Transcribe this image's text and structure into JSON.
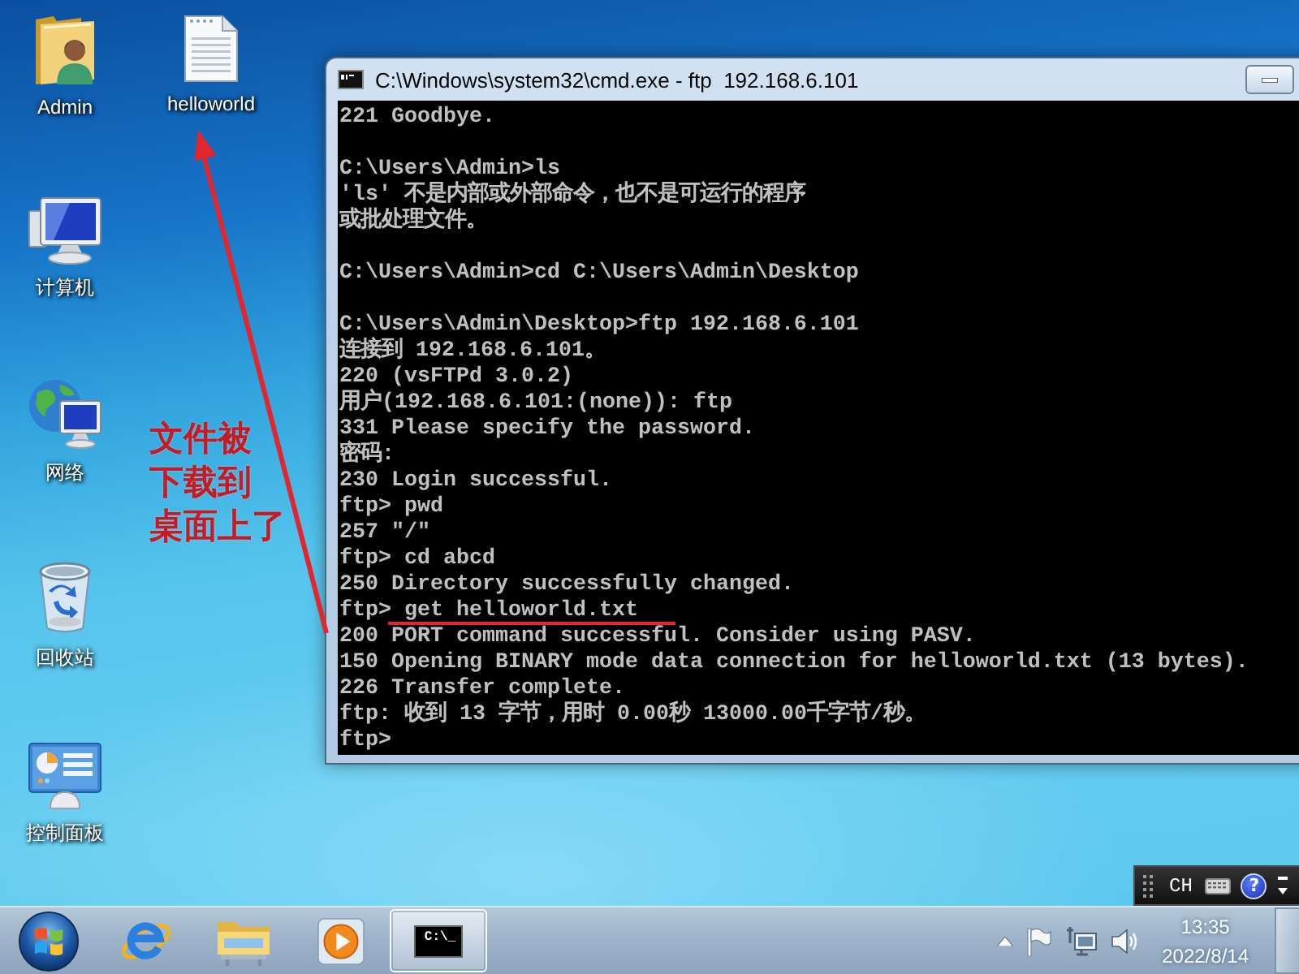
{
  "desktop": {
    "icon_columns": [
      [
        {
          "kind": "user-folder",
          "label": "Admin"
        },
        {
          "kind": "computer",
          "label": "计算机"
        },
        {
          "kind": "network",
          "label": "网络"
        },
        {
          "kind": "recycle-bin",
          "label": "回收站"
        },
        {
          "kind": "control-panel",
          "label": "控制面板"
        }
      ],
      [
        {
          "kind": "document",
          "label": "helloworld"
        }
      ]
    ]
  },
  "window": {
    "title": "C:\\Windows\\system32\\cmd.exe - ftp  192.168.6.101",
    "console_blocks": [
      [
        {
          "text": "221 Goodbye.",
          "underlined": false
        }
      ],
      [
        {
          "text": "C:\\Users\\Admin>ls",
          "underlined": false
        },
        {
          "text": "'ls' 不是内部或外部命令，也不是可运行的程序",
          "underlined": false
        },
        {
          "text": "或批处理文件。",
          "underlined": false
        }
      ],
      [
        {
          "text": "C:\\Users\\Admin>cd C:\\Users\\Admin\\Desktop",
          "underlined": false
        }
      ],
      [
        {
          "text": "C:\\Users\\Admin\\Desktop>ftp 192.168.6.101",
          "underlined": false
        },
        {
          "text": "连接到 192.168.6.101。",
          "underlined": false
        },
        {
          "text": "220 (vsFTPd 3.0.2)",
          "underlined": false
        },
        {
          "text": "用户(192.168.6.101:(none)): ftp",
          "underlined": false
        },
        {
          "text": "331 Please specify the password.",
          "underlined": false
        },
        {
          "text": "密码:",
          "underlined": false
        },
        {
          "text": "230 Login successful.",
          "underlined": false
        },
        {
          "text": "ftp> pwd",
          "underlined": false
        },
        {
          "text": "257 \"/\"",
          "underlined": false
        },
        {
          "text": "ftp> cd abcd",
          "underlined": false
        },
        {
          "text": "250 Directory successfully changed.",
          "underlined": false
        },
        {
          "text": "ftp> get helloworld.txt",
          "underlined": true
        },
        {
          "text": "200 PORT command successful. Consider using PASV.",
          "underlined": false
        },
        {
          "text": "150 Opening BINARY mode data connection for helloworld.txt (13 bytes).",
          "underlined": false
        },
        {
          "text": "226 Transfer complete.",
          "underlined": false
        },
        {
          "text": "ftp: 收到 13 字节，用时 0.00秒 13000.00千字节/秒。",
          "underlined": false
        },
        {
          "text": "ftp>",
          "underlined": false
        }
      ]
    ]
  },
  "annotation": {
    "lines": [
      "文件被",
      "下载到",
      "桌面上了"
    ]
  },
  "language_bar": {
    "language": "CH",
    "help": "?"
  },
  "taskbar": {
    "items": [
      {
        "kind": "start",
        "selected": false
      },
      {
        "kind": "browser",
        "selected": false
      },
      {
        "kind": "explorer",
        "selected": false
      },
      {
        "kind": "media",
        "selected": false
      },
      {
        "kind": "console",
        "glyph": "C:\\_",
        "selected": true
      }
    ]
  },
  "tray": {
    "time": "13:35",
    "date": "2022/8/14"
  }
}
